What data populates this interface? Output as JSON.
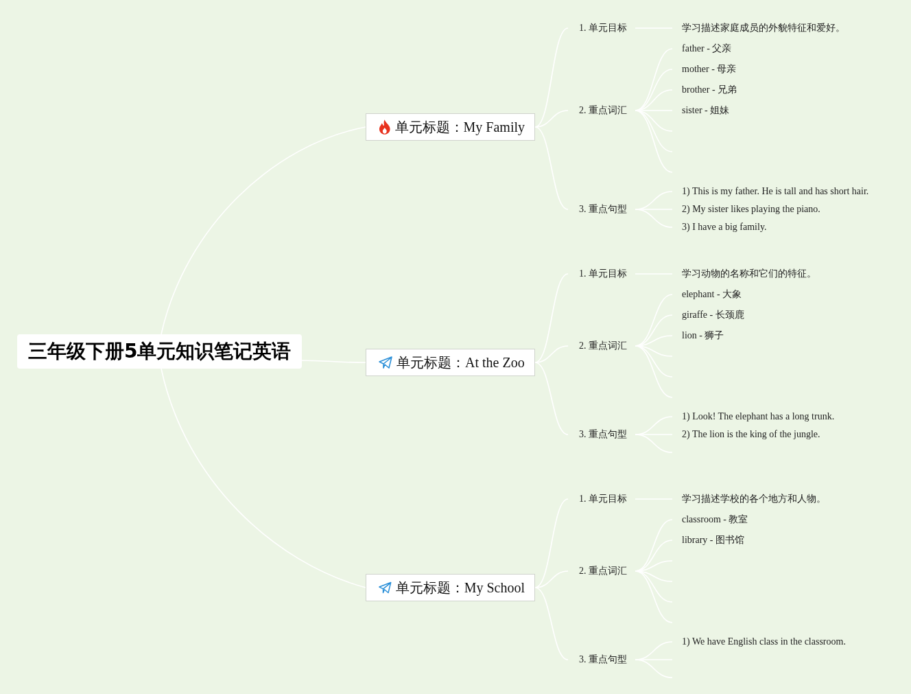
{
  "root": {
    "title": "三年级下册5单元知识笔记英语"
  },
  "units": [
    {
      "label": "单元标题：My Family",
      "sections": [
        {
          "kind": "goal",
          "label": "1. 单元目标",
          "items": [
            {
              "kind": "text",
              "text": "学习描述家庭成员的外貌特征和爱好。"
            }
          ]
        },
        {
          "kind": "vocab",
          "label": "2. 重点词汇",
          "items": [
            {
              "kind": "text",
              "text": "father - 父亲"
            },
            {
              "kind": "text",
              "text": "mother - 母亲"
            },
            {
              "kind": "text",
              "text": "brother - 兄弟"
            },
            {
              "kind": "text",
              "text": "sister - 姐妹"
            },
            {
              "kind": "blank"
            },
            {
              "kind": "blank"
            },
            {
              "kind": "blank"
            }
          ]
        },
        {
          "kind": "sentences",
          "label": "3. 重点句型",
          "items": [
            {
              "kind": "text",
              "text": "1) This is my father. He is tall and has short hair."
            },
            {
              "kind": "text",
              "text": "2) My sister likes playing the piano."
            },
            {
              "kind": "text",
              "text": "3) I have a big family."
            }
          ]
        }
      ]
    },
    {
      "label": "单元标题：At the Zoo",
      "sections": [
        {
          "kind": "goal",
          "label": "1. 单元目标",
          "items": [
            {
              "kind": "text",
              "text": "学习动物的名称和它们的特征。"
            }
          ]
        },
        {
          "kind": "vocab",
          "label": "2. 重点词汇",
          "items": [
            {
              "kind": "text",
              "text": "elephant - 大象"
            },
            {
              "kind": "text",
              "text": "giraffe - 长颈鹿"
            },
            {
              "kind": "text",
              "text": "lion - 狮子"
            },
            {
              "kind": "blank"
            },
            {
              "kind": "blank"
            },
            {
              "kind": "blank"
            }
          ]
        },
        {
          "kind": "sentences",
          "label": "3. 重点句型",
          "items": [
            {
              "kind": "text",
              "text": "1) Look! The elephant has a long trunk."
            },
            {
              "kind": "text",
              "text": "2) The lion is the king of the jungle."
            },
            {
              "kind": "blank"
            }
          ]
        }
      ]
    },
    {
      "label": "单元标题：My School",
      "sections": [
        {
          "kind": "goal",
          "label": "1. 单元目标",
          "items": [
            {
              "kind": "text",
              "text": "学习描述学校的各个地方和人物。"
            }
          ]
        },
        {
          "kind": "vocab",
          "label": "2. 重点词汇",
          "items": [
            {
              "kind": "text",
              "text": "classroom - 教室"
            },
            {
              "kind": "text",
              "text": "library - 图书馆"
            },
            {
              "kind": "blank"
            },
            {
              "kind": "blank"
            },
            {
              "kind": "blank"
            },
            {
              "kind": "blank"
            }
          ]
        },
        {
          "kind": "sentences",
          "label": "3. 重点句型",
          "items": [
            {
              "kind": "text",
              "text": "1) We have English class in the classroom."
            },
            {
              "kind": "blank"
            },
            {
              "kind": "blank"
            }
          ]
        }
      ]
    }
  ]
}
